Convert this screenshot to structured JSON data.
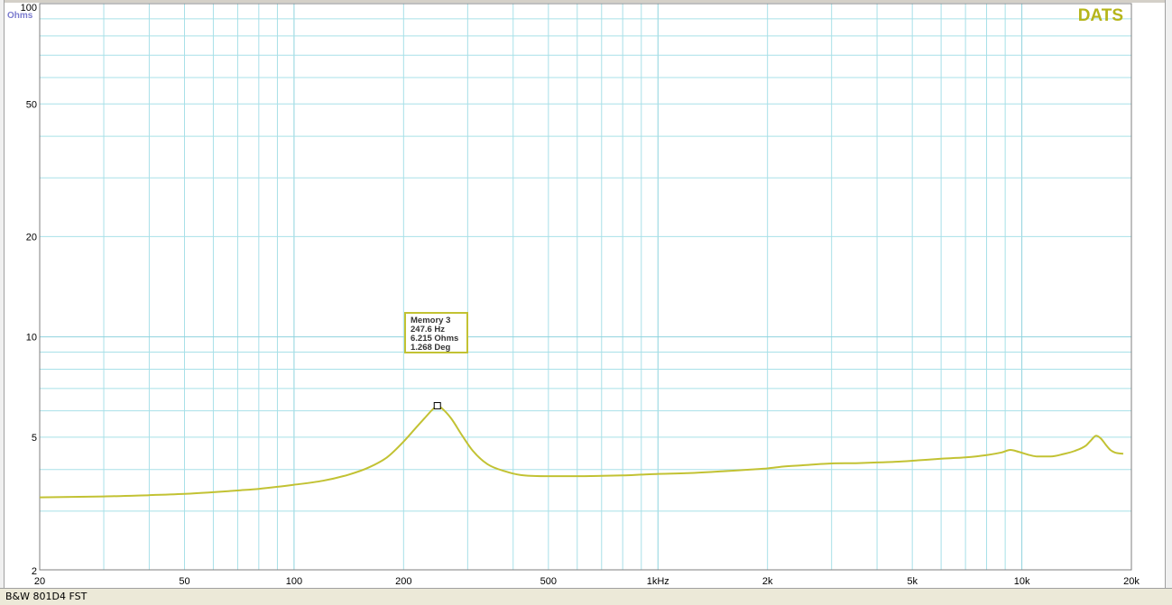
{
  "brand": {
    "label": "DATS",
    "color": "#b5b51a"
  },
  "status_bar": {
    "text": "B&W 801D4 FST"
  },
  "colors": {
    "grid": "#a8e0e8",
    "curve": "#c2c233",
    "axis_text": "#000000",
    "unit_text": "#7b7bcf"
  },
  "chart_data": {
    "type": "line",
    "x_scale": "log",
    "y_scale": "log",
    "xlim": [
      20,
      20000
    ],
    "ylim": [
      2,
      100
    ],
    "ylabel": "Ohms",
    "grid": true,
    "x_ticks": [
      {
        "value": 20,
        "label": "20"
      },
      {
        "value": 50,
        "label": "50"
      },
      {
        "value": 100,
        "label": "100"
      },
      {
        "value": 200,
        "label": "200"
      },
      {
        "value": 500,
        "label": "500"
      },
      {
        "value": 1000,
        "label": "1kHz"
      },
      {
        "value": 2000,
        "label": "2k"
      },
      {
        "value": 5000,
        "label": "5k"
      },
      {
        "value": 10000,
        "label": "10k"
      },
      {
        "value": 20000,
        "label": "20k"
      }
    ],
    "y_ticks": [
      {
        "value": 2,
        "label": "2"
      },
      {
        "value": 5,
        "label": "5"
      },
      {
        "value": 10,
        "label": "10"
      },
      {
        "value": 20,
        "label": "20"
      },
      {
        "value": 50,
        "label": "50"
      },
      {
        "value": 100,
        "label": "100"
      }
    ],
    "series": [
      {
        "x": [
          20,
          30,
          40,
          50,
          60,
          70,
          80,
          90,
          100,
          120,
          140,
          160,
          180,
          200,
          215,
          230,
          240,
          247.6,
          255,
          270,
          290,
          310,
          340,
          380,
          420,
          500,
          600,
          700,
          800,
          900,
          1000,
          1200,
          1500,
          1800,
          2000,
          2200,
          2500,
          3000,
          3500,
          4000,
          4500,
          5000,
          5500,
          6000,
          7000,
          8000,
          8800,
          9300,
          9800,
          10500,
          11000,
          12000,
          13000,
          14000,
          15000,
          15500,
          16000,
          16500,
          17000,
          17500,
          18000,
          19000
        ],
        "y": [
          3.3,
          3.32,
          3.35,
          3.38,
          3.42,
          3.46,
          3.5,
          3.55,
          3.6,
          3.7,
          3.85,
          4.05,
          4.35,
          4.85,
          5.3,
          5.75,
          6.05,
          6.215,
          6.1,
          5.7,
          5.05,
          4.55,
          4.15,
          3.95,
          3.85,
          3.82,
          3.82,
          3.83,
          3.84,
          3.86,
          3.88,
          3.9,
          3.95,
          4.0,
          4.03,
          4.08,
          4.12,
          4.17,
          4.18,
          4.2,
          4.22,
          4.25,
          4.28,
          4.31,
          4.35,
          4.42,
          4.5,
          4.58,
          4.52,
          4.42,
          4.38,
          4.38,
          4.45,
          4.55,
          4.72,
          4.9,
          5.05,
          4.95,
          4.75,
          4.58,
          4.5,
          4.46
        ]
      }
    ],
    "marker": {
      "x": 247.6,
      "y": 6.215,
      "lines": [
        "Memory 3",
        "247.6 Hz",
        "6.215 Ohms",
        "1.268 Deg"
      ]
    }
  }
}
